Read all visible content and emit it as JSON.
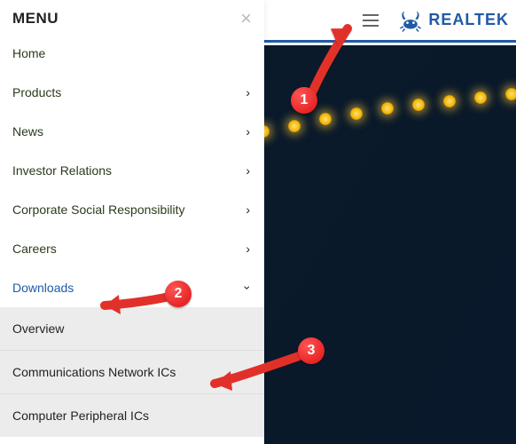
{
  "header": {
    "brand_text": "REALTEK"
  },
  "sidebar": {
    "title": "MENU",
    "items": [
      {
        "label": "Home",
        "has_children": false,
        "expanded": false
      },
      {
        "label": "Products",
        "has_children": true,
        "expanded": false
      },
      {
        "label": "News",
        "has_children": true,
        "expanded": false
      },
      {
        "label": "Investor Relations",
        "has_children": true,
        "expanded": false
      },
      {
        "label": "Corporate Social Responsibility",
        "has_children": true,
        "expanded": false
      },
      {
        "label": "Careers",
        "has_children": true,
        "expanded": false
      },
      {
        "label": "Downloads",
        "has_children": true,
        "expanded": true
      }
    ],
    "downloads_submenu": [
      {
        "label": "Overview"
      },
      {
        "label": "Communications Network ICs"
      },
      {
        "label": "Computer Peripheral ICs"
      }
    ]
  },
  "annotations": {
    "step1": "1",
    "step2": "2",
    "step3": "3"
  },
  "colors": {
    "accent": "#1f5aa6",
    "annotation": "#e1302a"
  }
}
